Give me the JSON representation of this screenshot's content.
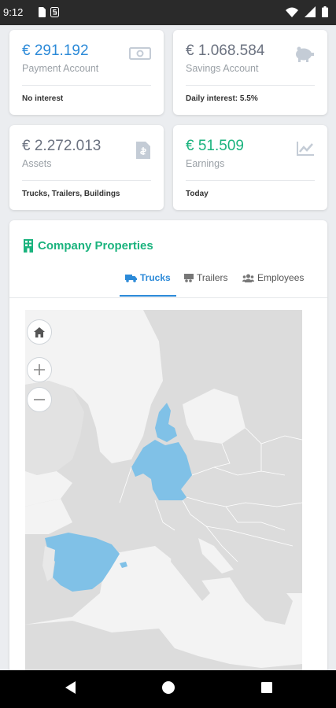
{
  "status_bar": {
    "time": "9:12"
  },
  "cards": [
    {
      "amount": "€ 291.192",
      "label": "Payment Account",
      "footer": "No interest",
      "amount_color": "#2c8ad8",
      "icon": "cash-icon"
    },
    {
      "amount": "€ 1.068.584",
      "label": "Savings Account",
      "footer": "Daily interest: 5.5%",
      "amount_color": "#6b7280",
      "icon": "piggy-bank-icon"
    },
    {
      "amount": "€ 2.272.013",
      "label": "Assets",
      "footer": "Trucks, Trailers, Buildings",
      "amount_color": "#6b7280",
      "icon": "invoice-icon"
    },
    {
      "amount": "€ 51.509",
      "label": "Earnings",
      "footer": "Today",
      "amount_color": "#1bb37e",
      "icon": "chart-line-icon"
    }
  ],
  "properties": {
    "title": "Company Properties",
    "tabs": [
      {
        "label": "Trucks",
        "icon": "truck-icon",
        "active": true
      },
      {
        "label": "Trailers",
        "icon": "trailer-icon",
        "active": false
      },
      {
        "label": "Employees",
        "icon": "users-icon",
        "active": false
      }
    ]
  },
  "map": {
    "highlighted_countries": [
      "Germany",
      "Denmark",
      "Spain"
    ],
    "highlight_color": "#80c1e7",
    "land_color": "#dcdcdc",
    "controls": [
      "home-icon",
      "zoom-in-icon",
      "zoom-out-icon"
    ]
  },
  "colors": {
    "accent_blue": "#2c8ad8",
    "accent_green": "#1bb37e",
    "background": "#ebedf0"
  }
}
